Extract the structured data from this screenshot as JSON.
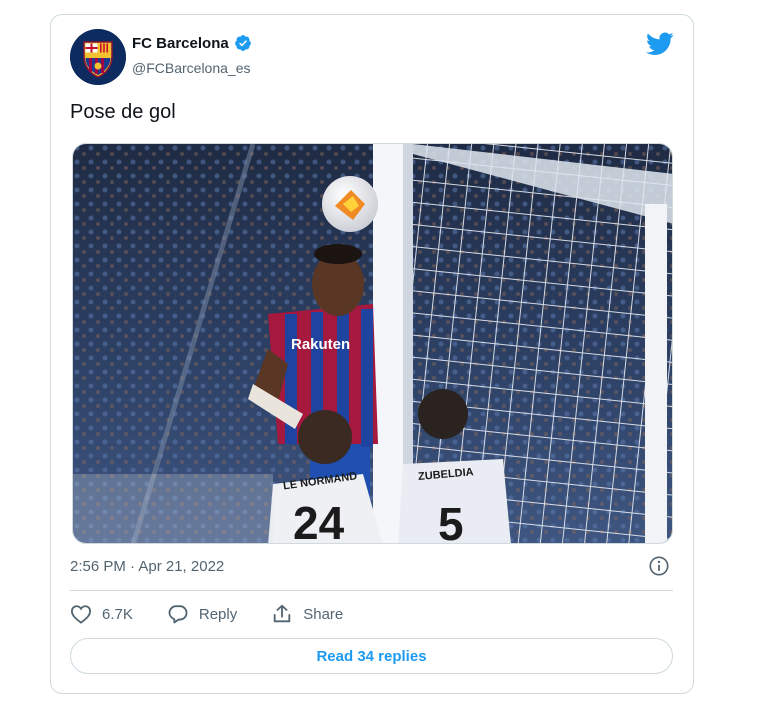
{
  "tweet": {
    "author_name": "FC Barcelona",
    "author_handle": "@FCBarcelona_es",
    "verified": true,
    "text": "Pose de gol",
    "timestamp": "2:56 PM · Apr 21, 2022",
    "likes": "6.7K",
    "reply_label": "Reply",
    "share_label": "Share",
    "read_replies_label": "Read 34 replies"
  },
  "colors": {
    "accent": "#1d9bf0",
    "text": "#0f1419",
    "muted": "#536471",
    "border": "#cfd9de"
  },
  "icons": {
    "logo": "twitter-bird-icon",
    "verified": "verified-badge-icon",
    "info": "info-icon",
    "like": "heart-icon",
    "reply": "reply-bubble-icon",
    "share": "share-upload-icon"
  }
}
